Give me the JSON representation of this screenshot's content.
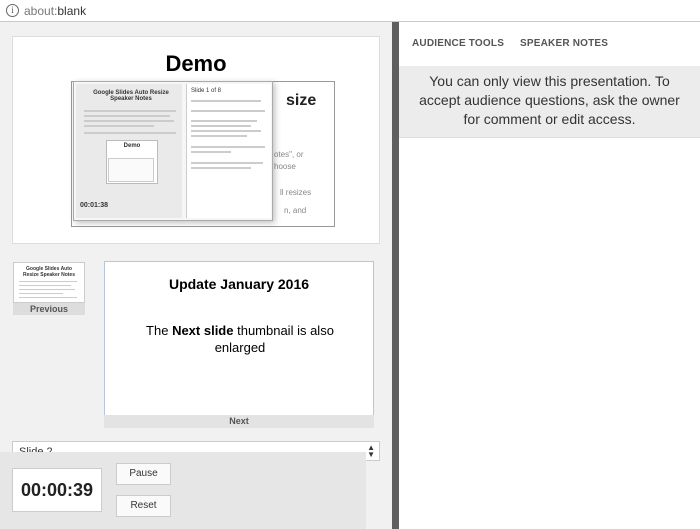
{
  "browser": {
    "url_prefix": "about:",
    "url_rest": "blank"
  },
  "current_slide": {
    "title": "Demo",
    "background_heading": "size",
    "background_lines": [
      "otes\", or",
      "hoose",
      "ll resizes",
      "n, and"
    ],
    "popup": {
      "header": "Slide 1 of 8",
      "slide_title": "Google Slides Auto Resize Speaker Notes",
      "mini_title": "Demo",
      "timer": "00:01:38"
    }
  },
  "previous": {
    "thumb_title": "Google Slides Auto Resize Speaker Notes",
    "label": "Previous"
  },
  "next": {
    "title": "Update January 2016",
    "body_prefix": "The ",
    "body_bold": "Next slide",
    "body_suffix": " thumbnail is also enlarged",
    "label": "Next"
  },
  "slide_select": {
    "value": "Slide 2"
  },
  "timer": {
    "value": "00:00:39"
  },
  "buttons": {
    "pause": "Pause",
    "reset": "Reset"
  },
  "right_panel": {
    "tabs": [
      "AUDIENCE TOOLS",
      "SPEAKER NOTES"
    ],
    "notice": "You can only view this presentation. To accept audience questions, ask the owner for comment or edit access."
  },
  "colors": {
    "divider": "#5f5f5f",
    "notice_bg": "#ececec"
  }
}
